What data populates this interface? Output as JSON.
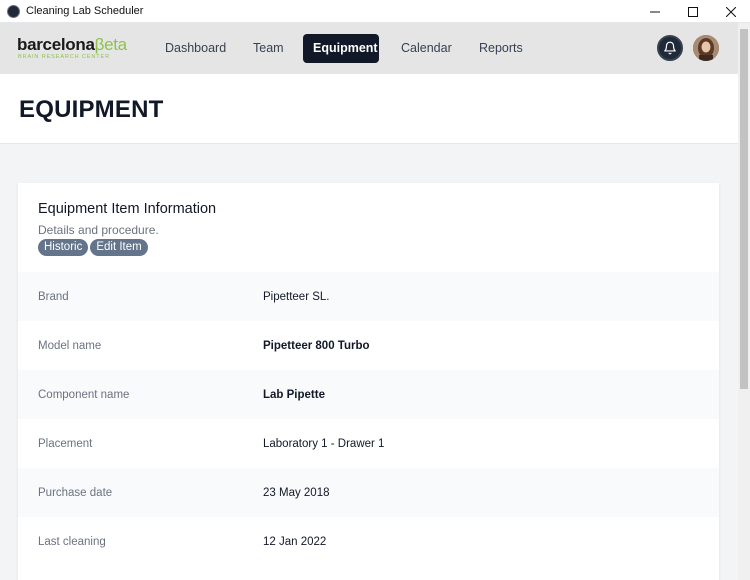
{
  "window": {
    "title": "Cleaning Lab Scheduler"
  },
  "brand": {
    "name_main": "barcelona",
    "name_accent": "βeta",
    "tagline": "BRAIN RESEARCH CENTER"
  },
  "nav": {
    "items": [
      {
        "label": "Dashboard",
        "active": false
      },
      {
        "label": "Team",
        "active": false
      },
      {
        "label": "Equipment",
        "active": true
      },
      {
        "label": "Calendar",
        "active": false
      },
      {
        "label": "Reports",
        "active": false
      }
    ]
  },
  "page": {
    "title": "EQUIPMENT"
  },
  "card": {
    "title": "Equipment Item Information",
    "subtitle": "Details and procedure.",
    "actions": [
      {
        "label": "Historic"
      },
      {
        "label": "Edit Item"
      }
    ],
    "rows": [
      {
        "label": "Brand",
        "value": "Pipetteer SL.",
        "bold": false
      },
      {
        "label": "Model name",
        "value": "Pipetteer 800 Turbo",
        "bold": true
      },
      {
        "label": "Component name",
        "value": "Lab Pipette",
        "bold": true
      },
      {
        "label": "Placement",
        "value": "Laboratory 1 - Drawer 1",
        "bold": false
      },
      {
        "label": "Purchase date",
        "value": "23 May 2018",
        "bold": false
      },
      {
        "label": "Last cleaning",
        "value": "12 Jan 2022",
        "bold": false
      }
    ]
  },
  "colors": {
    "nav_active_bg": "#111827",
    "pill_bg": "#64748b",
    "brand_accent": "#8bc34a"
  },
  "icons": {
    "notifications": "bell-icon",
    "minimize": "minimize-icon",
    "maximize": "maximize-icon",
    "close": "close-icon"
  }
}
